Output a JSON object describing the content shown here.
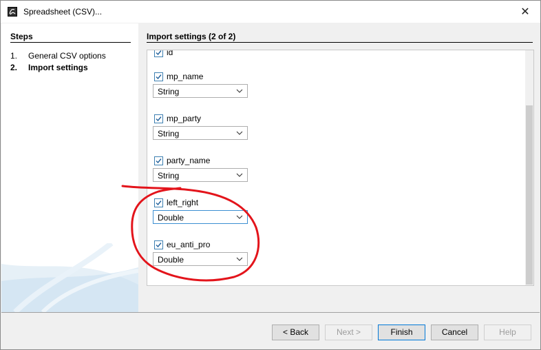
{
  "window": {
    "title": "Spreadsheet (CSV)...",
    "close_label": "✕"
  },
  "steps": {
    "title": "Steps",
    "items": [
      {
        "num": "1.",
        "label": "General CSV options"
      },
      {
        "num": "2.",
        "label": "Import settings"
      }
    ]
  },
  "import": {
    "title": "Import settings (2 of 2)",
    "fields": [
      {
        "name": "id",
        "checked": true
      },
      {
        "name": "mp_name",
        "type": "String",
        "checked": true
      },
      {
        "name": "mp_party",
        "type": "String",
        "checked": true
      },
      {
        "name": "party_name",
        "type": "String",
        "checked": true
      },
      {
        "name": "left_right",
        "type": "Double",
        "checked": true
      },
      {
        "name": "eu_anti_pro",
        "type": "Double",
        "checked": true
      }
    ]
  },
  "buttons": {
    "back": "< Back",
    "next": "Next >",
    "finish": "Finish",
    "cancel": "Cancel",
    "help": "Help"
  },
  "colors": {
    "annotation": "#e3141b",
    "checkbox_border": "#3c7fb1",
    "focus_border": "#3b8ed1"
  }
}
